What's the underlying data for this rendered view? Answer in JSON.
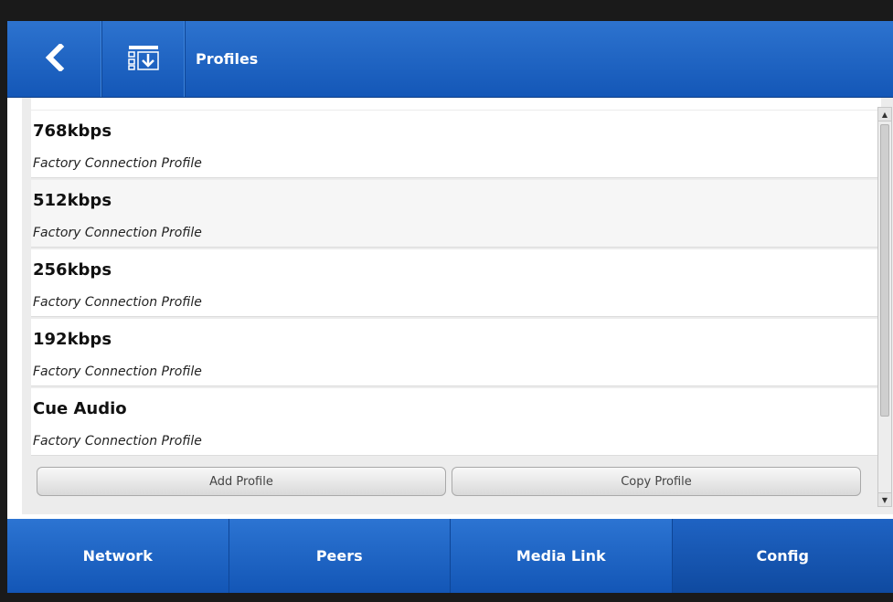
{
  "header": {
    "title": "Profiles",
    "back_icon": "chevron-left-icon",
    "list_icon": "list-download-icon"
  },
  "profiles": [
    {
      "name": "768kbps",
      "description": "Factory Connection Profile"
    },
    {
      "name": "512kbps",
      "description": "Factory Connection Profile"
    },
    {
      "name": "256kbps",
      "description": "Factory Connection Profile"
    },
    {
      "name": "192kbps",
      "description": "Factory Connection Profile"
    },
    {
      "name": "Cue Audio",
      "description": "Factory Connection Profile"
    }
  ],
  "actions": {
    "add_label": "Add Profile",
    "copy_label": "Copy Profile"
  },
  "nav": {
    "tabs": [
      {
        "label": "Network"
      },
      {
        "label": "Peers"
      },
      {
        "label": "Media Link"
      },
      {
        "label": "Config"
      }
    ],
    "active": "Config"
  },
  "colors": {
    "header_blue": "#1e63c2",
    "nav_blue": "#1356b6"
  }
}
